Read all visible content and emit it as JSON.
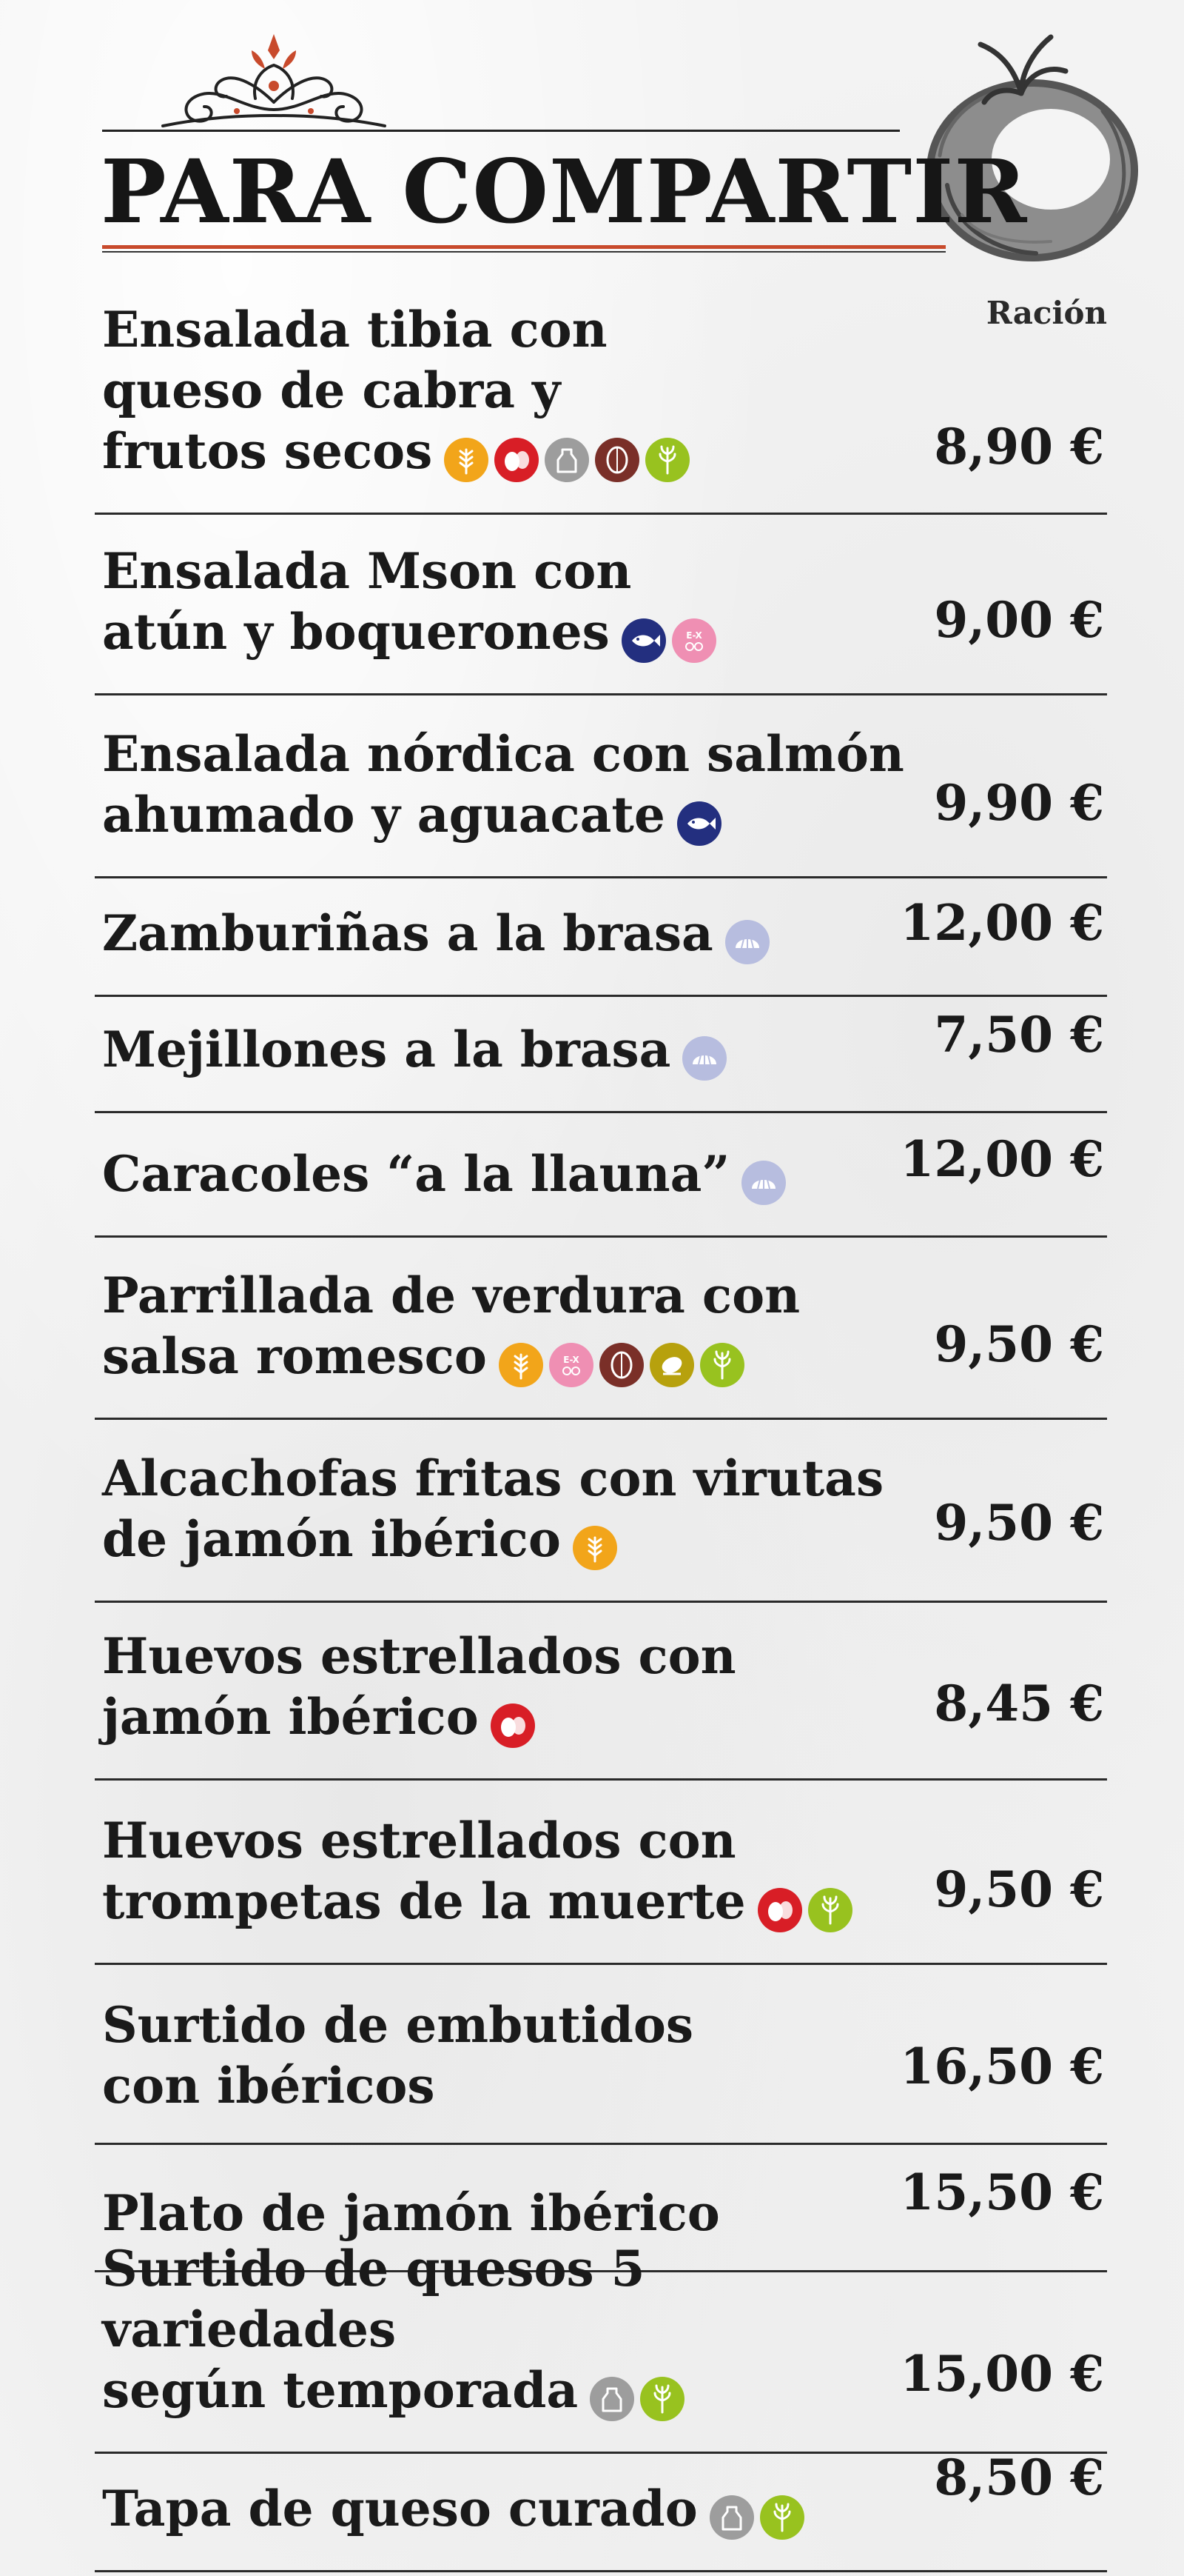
{
  "title": "PARA COMPARTIR",
  "column_label": "Ración",
  "ornament": "decorative-flourish",
  "illustration": "tomato-sketch",
  "allergen_colors": {
    "gluten": "#f2a51a",
    "egg": "#d81e26",
    "dairy": "#9d9d9d",
    "nut": "#7a2f28",
    "celery": "#98c21f",
    "fish": "#232f7f",
    "sulphite": "#ef8fb3",
    "shellfish": "#b7bddf",
    "sesame": "#b7a10d"
  },
  "items": [
    {
      "lines": [
        "Ensalada tibia con",
        "queso de cabra y",
        "frutos secos"
      ],
      "price": "8,90 €",
      "allergens": [
        "gluten-icon",
        "egg-icon",
        "dairy-icon",
        "nut-icon",
        "celery-icon"
      ]
    },
    {
      "lines": [
        "Ensalada Mson con",
        "atún y boquerones"
      ],
      "price": "9,00 €",
      "allergens": [
        "fish-icon",
        "sulphite-icon"
      ]
    },
    {
      "lines": [
        "Ensalada nórdica con salmón",
        "ahumado y aguacate"
      ],
      "price": "9,90 €",
      "allergens": [
        "fish-icon"
      ]
    },
    {
      "lines": [
        "Zamburiñas a la brasa"
      ],
      "price": "12,00 €",
      "allergens": [
        "shellfish-icon"
      ]
    },
    {
      "lines": [
        "Mejillones a la brasa"
      ],
      "price": "7,50 €",
      "allergens": [
        "shellfish-icon"
      ]
    },
    {
      "lines": [
        "Caracoles “a la llauna”"
      ],
      "price": "12,00 €",
      "allergens": [
        "shellfish-icon"
      ]
    },
    {
      "lines": [
        "Parrillada de verdura con",
        "salsa romesco"
      ],
      "price": "9,50 €",
      "allergens": [
        "gluten-icon",
        "sulphite-icon",
        "nut-icon",
        "sesame-icon",
        "celery-icon"
      ]
    },
    {
      "lines": [
        "Alcachofas fritas con virutas",
        "de jamón ibérico"
      ],
      "price": "9,50 €",
      "allergens": [
        "gluten-icon"
      ]
    },
    {
      "lines": [
        "Huevos estrellados con",
        "jamón ibérico"
      ],
      "price": "8,45 €",
      "allergens": [
        "egg-icon"
      ]
    },
    {
      "lines": [
        "Huevos estrellados con",
        "trompetas de la muerte"
      ],
      "price": "9,50 €",
      "allergens": [
        "egg-icon",
        "celery-icon"
      ]
    },
    {
      "lines": [
        "Surtido de embutidos",
        "con ibéricos"
      ],
      "price": "16,50 €",
      "allergens": []
    },
    {
      "lines": [
        "Plato de jamón ibérico"
      ],
      "price": "15,50 €",
      "allergens": []
    },
    {
      "lines": [
        "Surtido de quesos 5 variedades",
        "según temporada"
      ],
      "price": "15,00 €",
      "allergens": [
        "dairy-icon",
        "celery-icon"
      ]
    },
    {
      "lines": [
        "Tapa de queso curado"
      ],
      "price": "8,50 €",
      "allergens": [
        "dairy-icon",
        "celery-icon"
      ]
    }
  ]
}
